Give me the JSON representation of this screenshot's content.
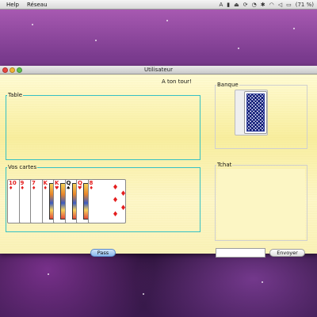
{
  "menubar": {
    "items": [
      "Help",
      "Réseau"
    ],
    "status": {
      "input_source": "A",
      "battery": "(71 %)"
    }
  },
  "window": {
    "title": "Utilisateur",
    "turn_message": "A ton tour!",
    "table_label": "Table",
    "cards_label": "Vos cartes",
    "bank_label": "Banque",
    "chat_label": "Tchat",
    "pass_label": "Pass",
    "send_label": "Envoyer",
    "chat_input_value": ""
  },
  "hand": [
    {
      "rank": "10",
      "suit": "♦",
      "color": "red"
    },
    {
      "rank": "9",
      "suit": "♦",
      "color": "red"
    },
    {
      "rank": "7",
      "suit": "♦",
      "color": "red"
    },
    {
      "rank": "K",
      "suit": "♦",
      "color": "red"
    },
    {
      "rank": "K",
      "suit": "♥",
      "color": "red"
    },
    {
      "rank": "Q",
      "suit": "♠",
      "color": "black"
    },
    {
      "rank": "Q",
      "suit": "♥",
      "color": "red"
    },
    {
      "rank": "8",
      "suit": "♦",
      "color": "red"
    }
  ],
  "colors": {
    "window_bg": "#fbf5c6",
    "group_border": "#36c1c4",
    "card_red": "#e41f1f",
    "card_back": "#2b3a99"
  }
}
